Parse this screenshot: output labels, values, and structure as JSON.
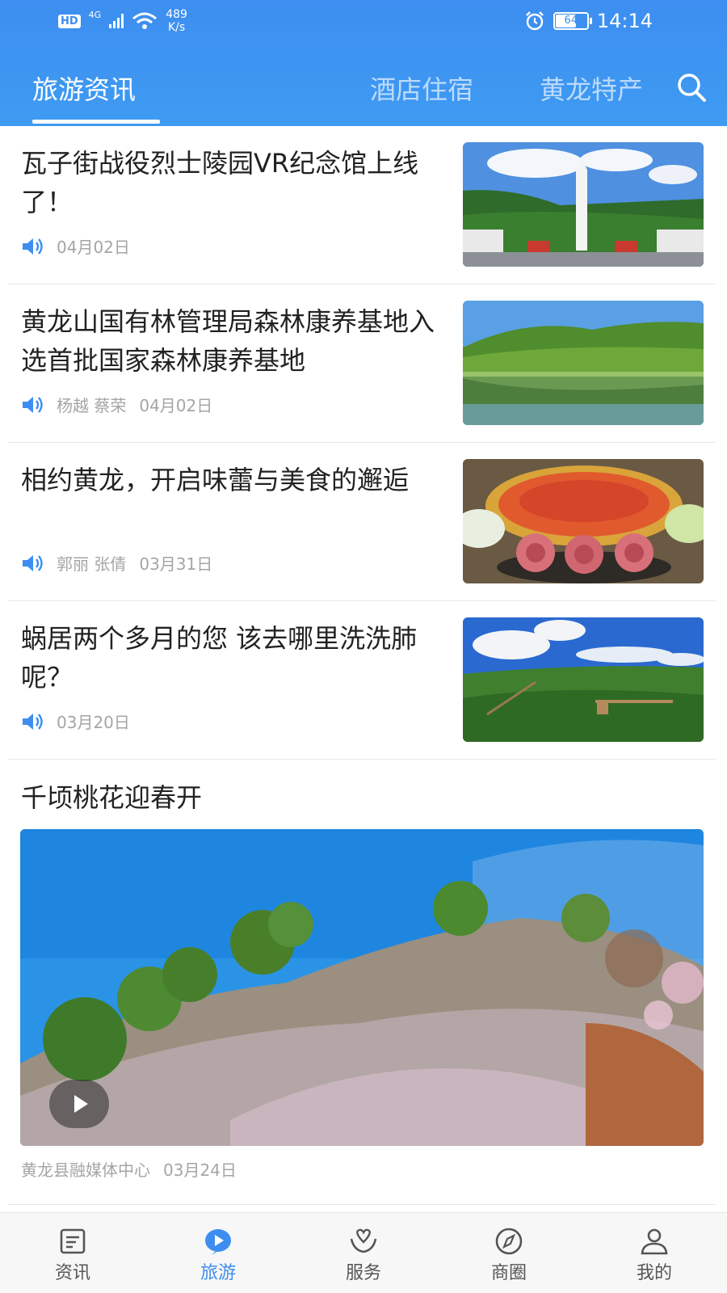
{
  "status_bar": {
    "hd": "HD",
    "network": "4G",
    "speed_value": "489",
    "speed_unit": "K/s",
    "battery": "64",
    "time": "14:14"
  },
  "tabs": [
    {
      "label": "旅游资讯",
      "active": true
    },
    {
      "label": "酒店住宿",
      "active": false
    },
    {
      "label": "黄龙特产",
      "active": false
    }
  ],
  "icons": {
    "search": "search-icon",
    "speaker": "speaker-icon",
    "play": "play-icon"
  },
  "colors": {
    "accent": "#3d8ef0",
    "meta_text": "#a5a5a5"
  },
  "news": [
    {
      "title": "瓦子街战役烈士陵园VR纪念馆上线了！",
      "author": "",
      "date": "04月02日",
      "image": "烈士陵园纪念碑"
    },
    {
      "title": "黄龙山国有林管理局森林康养基地入选首批国家森林康养基地",
      "author": "杨越 蔡荣",
      "date": "04月02日",
      "image": "湖光山色"
    },
    {
      "title": "相约黄龙，开启味蕾与美食的邂逅",
      "author": "郭丽 张倩",
      "date": "03月31日",
      "image": "火锅美食"
    },
    {
      "title": "蜗居两个多月的您 该去哪里洗洗肺呢？",
      "author": "",
      "date": "03月20日",
      "image": "森林观景台"
    }
  ],
  "video": {
    "title": "千顷桃花迎春开",
    "source": "黄龙县融媒体中心",
    "date": "03月24日"
  },
  "bottom_nav": [
    {
      "label": "资讯",
      "icon": "news-icon",
      "active": false
    },
    {
      "label": "旅游",
      "icon": "travel-play-icon",
      "active": true
    },
    {
      "label": "服务",
      "icon": "service-heart-icon",
      "active": false
    },
    {
      "label": "商圈",
      "icon": "compass-icon",
      "active": false
    },
    {
      "label": "我的",
      "icon": "profile-icon",
      "active": false
    }
  ]
}
